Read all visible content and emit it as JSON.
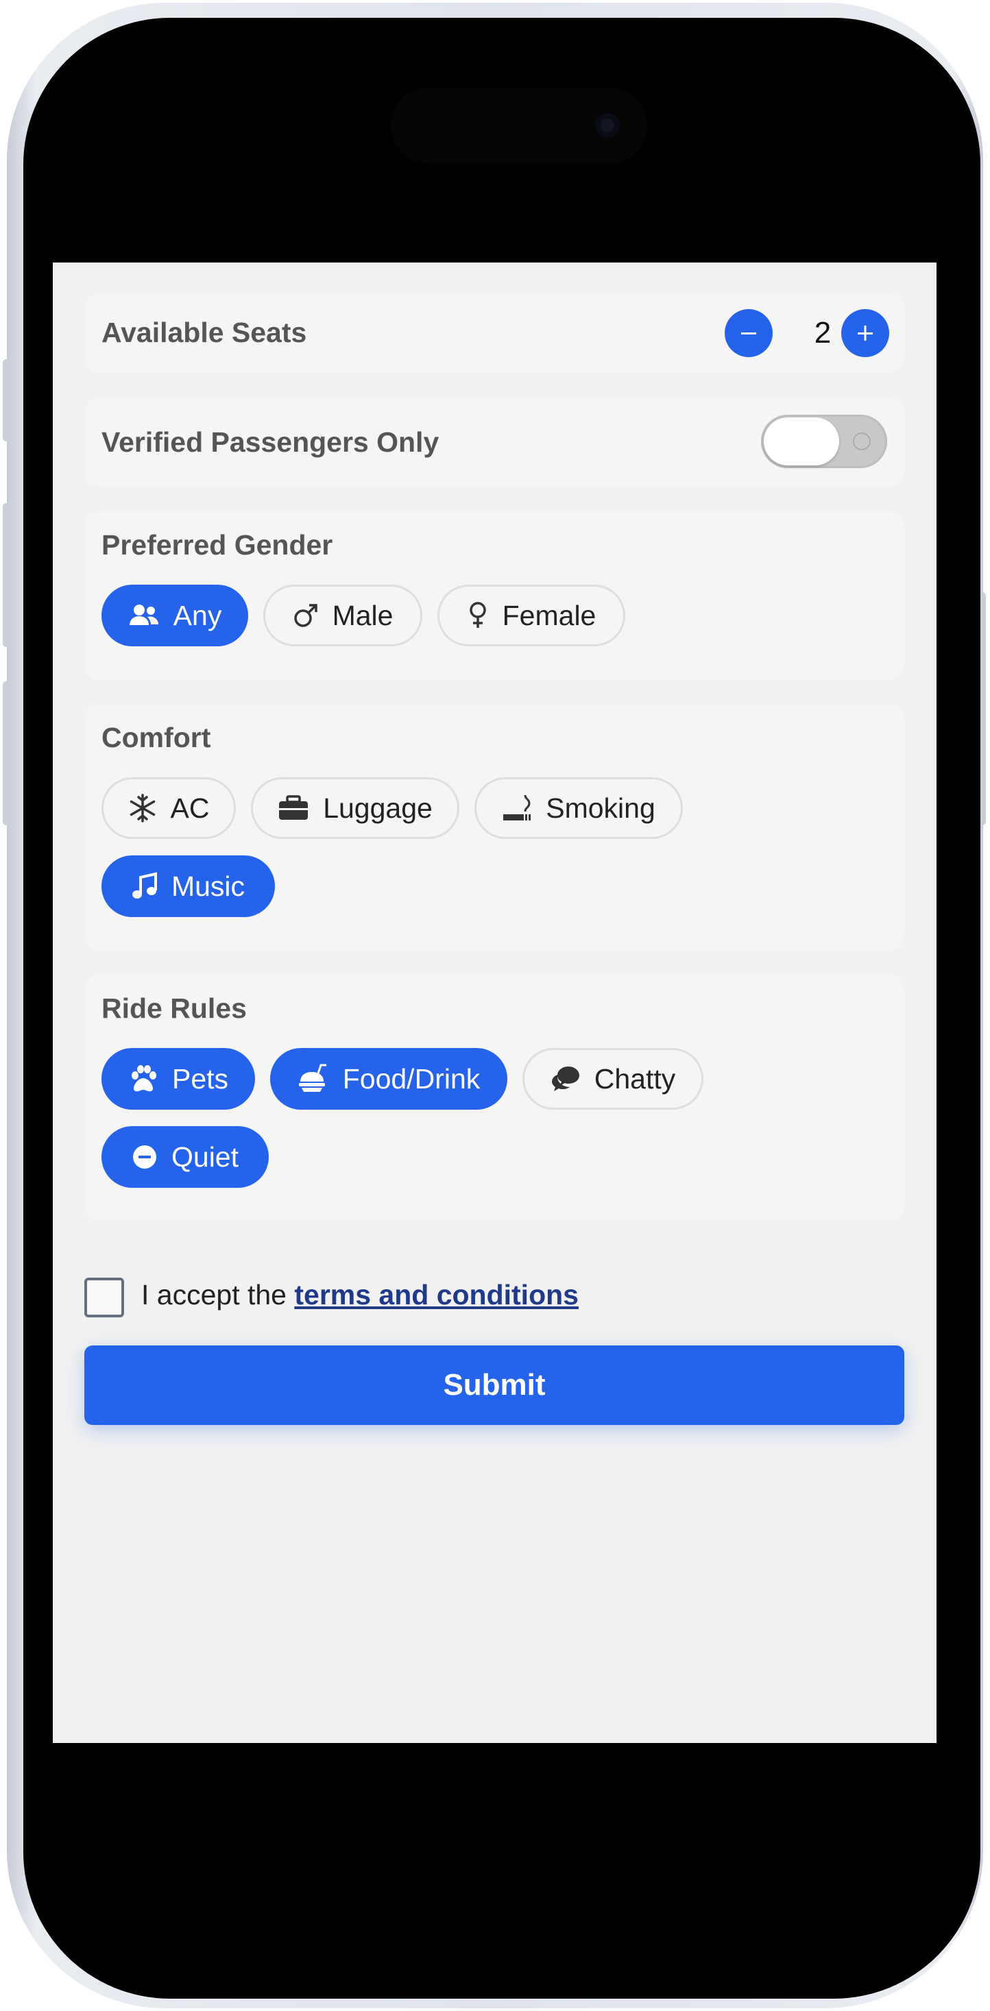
{
  "seats": {
    "label": "Available Seats",
    "value": "2"
  },
  "verified": {
    "label": "Verified Passengers Only",
    "enabled": false
  },
  "gender": {
    "title": "Preferred Gender",
    "options": [
      {
        "label": "Any",
        "icon": "users-icon",
        "selected": true
      },
      {
        "label": "Male",
        "icon": "male-icon",
        "selected": false
      },
      {
        "label": "Female",
        "icon": "female-icon",
        "selected": false
      }
    ]
  },
  "comfort": {
    "title": "Comfort",
    "options": [
      {
        "label": "AC",
        "icon": "snowflake-icon",
        "selected": false
      },
      {
        "label": "Luggage",
        "icon": "briefcase-icon",
        "selected": false
      },
      {
        "label": "Smoking",
        "icon": "smoking-icon",
        "selected": false
      },
      {
        "label": "Music",
        "icon": "music-icon",
        "selected": true
      }
    ]
  },
  "rules": {
    "title": "Ride Rules",
    "options": [
      {
        "label": "Pets",
        "icon": "paw-icon",
        "selected": true
      },
      {
        "label": "Food/Drink",
        "icon": "food-drink-icon",
        "selected": true
      },
      {
        "label": "Chatty",
        "icon": "chat-icon",
        "selected": false
      },
      {
        "label": "Quiet",
        "icon": "minus-circle-icon",
        "selected": true
      }
    ]
  },
  "terms": {
    "prefix": "I accept the ",
    "link": "terms and conditions",
    "checked": false
  },
  "submit_label": "Submit",
  "colors": {
    "accent": "#2563eb",
    "background": "#f1f1f1",
    "card": "#f5f5f5",
    "link": "#1f3a8a"
  }
}
